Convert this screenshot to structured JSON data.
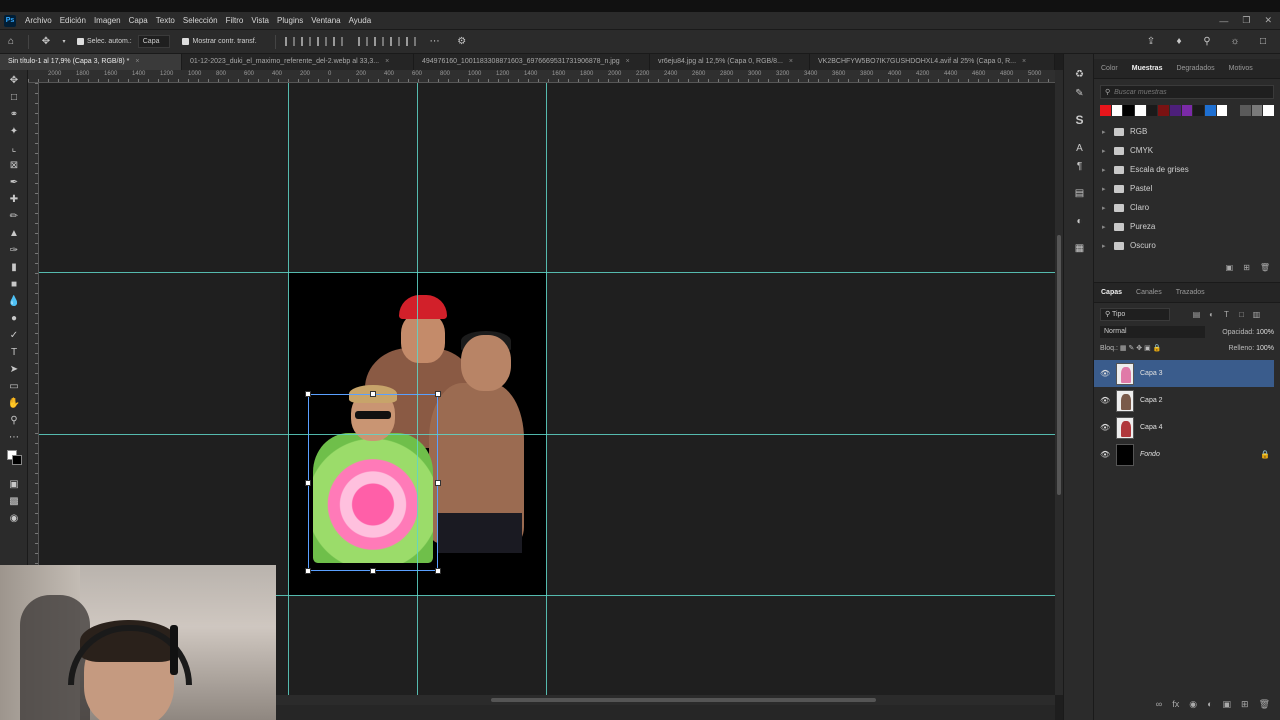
{
  "app": {
    "logo": "Ps",
    "menu": [
      "Archivo",
      "Edición",
      "Imagen",
      "Capa",
      "Texto",
      "Selección",
      "Filtro",
      "Vista",
      "Plugins",
      "Ventana",
      "Ayuda"
    ]
  },
  "options": {
    "auto_select_label": "Selec. autom.:",
    "auto_select_value": "Capa",
    "show_transform_label": "Mostrar contr. transf."
  },
  "tabs": [
    {
      "label": "Sin título-1 al 17,9% (Capa 3, RGB/8) *",
      "active": true
    },
    {
      "label": "01-12-2023_duki_el_maximo_referente_del-2.webp al 33,3...",
      "active": false
    },
    {
      "label": "494976160_1001183308871603_6976669531731906878_n.jpg",
      "active": false
    },
    {
      "label": "vr6eju84.jpg al 12,5% (Capa 0, RGB/8...",
      "active": false
    },
    {
      "label": "VK2BCHFYW5BO7IK7GUSHDOHXL4.avif al 25% (Capa 0, R...",
      "active": false
    }
  ],
  "ruler_labels": [
    "2000",
    "1800",
    "1600",
    "1400",
    "1200",
    "1000",
    "800",
    "600",
    "400",
    "200",
    "0",
    "200",
    "400",
    "600",
    "800",
    "1000",
    "1200",
    "1400",
    "1600",
    "1800",
    "2000",
    "2200",
    "2400",
    "2600",
    "2800",
    "3000",
    "3200",
    "3400",
    "3600",
    "3800",
    "4000",
    "4200",
    "4400",
    "4600",
    "4800",
    "5000"
  ],
  "swatches_panel": {
    "tabs": [
      "Color",
      "Muestras",
      "Degradados",
      "Motivos"
    ],
    "active_tab": "Muestras",
    "search_placeholder": "Buscar muestras",
    "swatch_colors": [
      "#e8151b",
      "#ffffff",
      "#000000",
      "#ffffff",
      "#1a1a1a",
      "#7a1212",
      "#4d1f7a",
      "#7b2aa8",
      "#1a1a1a",
      "#1e6fd1",
      "#ffffff",
      "#2b2b2b",
      "#5a5a5a",
      "#7a7a7a",
      "#ffffff"
    ],
    "folders": [
      "RGB",
      "CMYK",
      "Escala de grises",
      "Pastel",
      "Claro",
      "Pureza",
      "Oscuro"
    ]
  },
  "layers_panel": {
    "tabs": [
      "Capas",
      "Canales",
      "Trazados"
    ],
    "active_tab": "Capas",
    "filter": "Tipo",
    "blend_mode": "Normal",
    "opacity_label": "Opacidad:",
    "opacity_value": "100%",
    "lock_label": "Bloq.:",
    "fill_label": "Relleno:",
    "fill_value": "100%",
    "layers": [
      {
        "name": "Capa 3",
        "selected": true,
        "locked": false
      },
      {
        "name": "Capa 2",
        "selected": false,
        "locked": false
      },
      {
        "name": "Capa 4",
        "selected": false,
        "locked": false
      },
      {
        "name": "Fondo",
        "selected": false,
        "locked": true
      }
    ]
  },
  "colors": {
    "guide": "#5fd6c8",
    "selection_highlight": "#3a5c8c",
    "transform_box": "#5aa0ff"
  }
}
